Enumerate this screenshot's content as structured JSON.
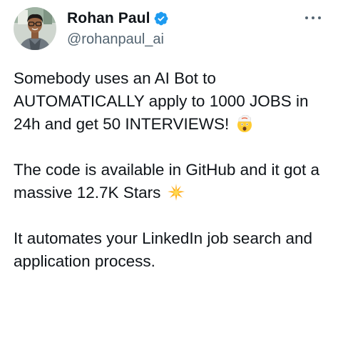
{
  "author": {
    "display_name": "Rohan Paul",
    "handle": "@rohanpaul_ai",
    "verified": true
  },
  "icons": {
    "verified": "verified-badge-icon",
    "more": "more-options-icon",
    "exploding_head": "exploding-head-emoji",
    "star": "glowing-star-emoji"
  },
  "colors": {
    "verified_blue": "#1d9bf0",
    "text_primary": "#0f1419",
    "text_secondary": "#536471"
  },
  "tweet": {
    "paragraphs": [
      {
        "text": "Somebody uses an AI Bot to AUTOMATICALLY apply to 1000 JOBS in 24h and get 50 INTERVIEWS! ",
        "emoji": "exploding-head-emoji"
      },
      {
        "text": "The code is available in GitHub and it got a massive 12.7K Stars ",
        "emoji": "glowing-star-emoji"
      },
      {
        "text": "It automates your LinkedIn job search and application process."
      }
    ]
  }
}
